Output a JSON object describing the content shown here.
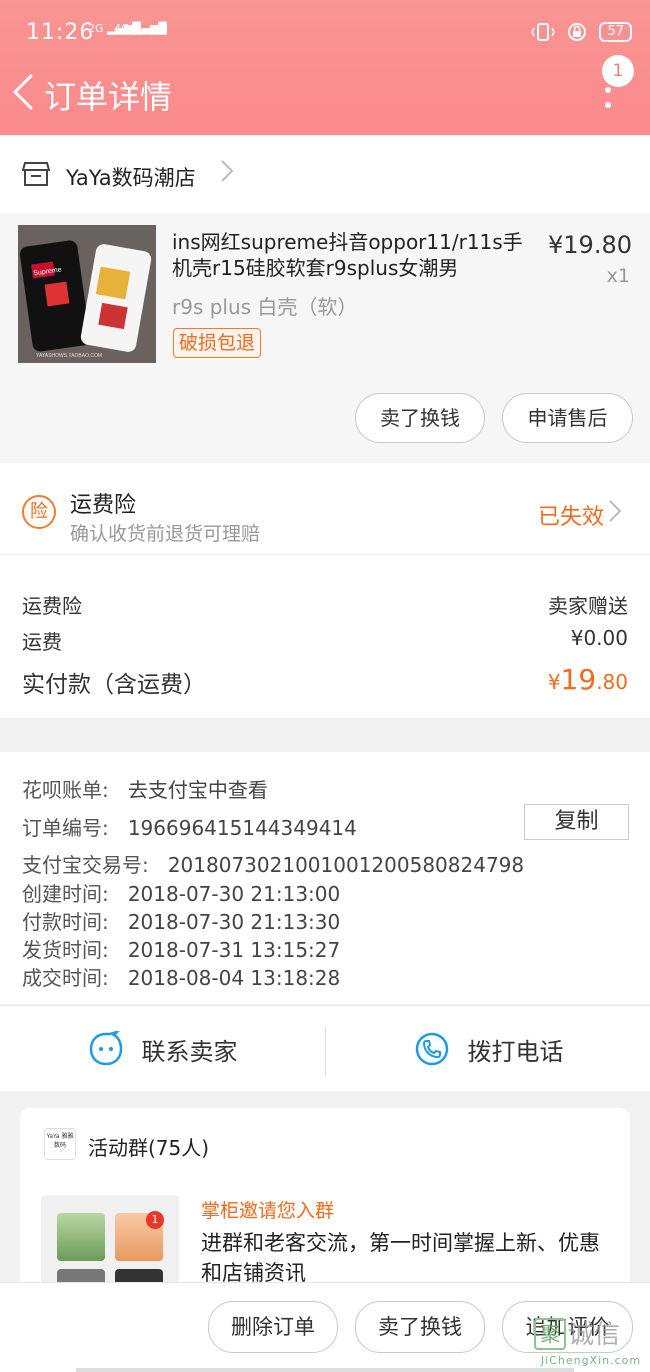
{
  "status_bar": {
    "time": "11:26",
    "signal1": "2G",
    "signal2": "4G",
    "battery": "57"
  },
  "header": {
    "title": "订单详情",
    "badge_count": "1"
  },
  "shop": {
    "name": "YaYa数码潮店"
  },
  "product": {
    "title": "ins网红supreme抖音oppor11/r11s手机壳r15硅胶软套r9splus女潮男",
    "price": "¥19.80",
    "quantity": "x1",
    "spec": "r9s plus 白壳（软）",
    "tag": "破损包退",
    "image_text": "YAYASHOWS.TAOBAO.COM",
    "image_brand": "Supreme"
  },
  "product_actions": {
    "sell": "卖了换钱",
    "after_sale": "申请售后"
  },
  "insurance": {
    "icon_text": "险",
    "title": "运费险",
    "desc": "确认收货前退货可理赔",
    "status": "已失效"
  },
  "fees": {
    "insurance_label": "运费险",
    "insurance_value": "卖家赠送",
    "shipping_label": "运费",
    "shipping_value": "¥0.00",
    "total_label": "实付款（含运费）",
    "total_symbol": "¥",
    "total_int": "19",
    "total_dec": ".80"
  },
  "order_info": {
    "huabei_label": "花呗账单:",
    "huabei_value": "去支付宝中查看",
    "order_no_label": "订单编号:",
    "order_no": "196696415144349414",
    "copy_label": "复制",
    "alipay_label": "支付宝交易号:",
    "alipay_no": "2018073021001001200580824798",
    "created_label": "创建时间:",
    "created": "2018-07-30 21:13:00",
    "paid_label": "付款时间:",
    "paid": "2018-07-30 21:13:30",
    "shipped_label": "发货时间:",
    "shipped": "2018-07-31 13:15:27",
    "completed_label": "成交时间:",
    "completed": "2018-08-04 13:18:28"
  },
  "contact": {
    "seller": "联系卖家",
    "phone": "拨打电话"
  },
  "group": {
    "logo_text": "YaYa 雅雅 数码",
    "name": "活动群(75人)",
    "badge": "1",
    "invite": "掌柜邀请您入群",
    "desc": "进群和老客交流，第一时间掌握上新、优惠和店铺资讯"
  },
  "bottom_actions": {
    "delete": "删除订单",
    "sell": "卖了换钱",
    "review": "追加评价"
  },
  "watermark": {
    "logo": "聚",
    "text": "诚信",
    "sub": "JiChengXin.com"
  }
}
